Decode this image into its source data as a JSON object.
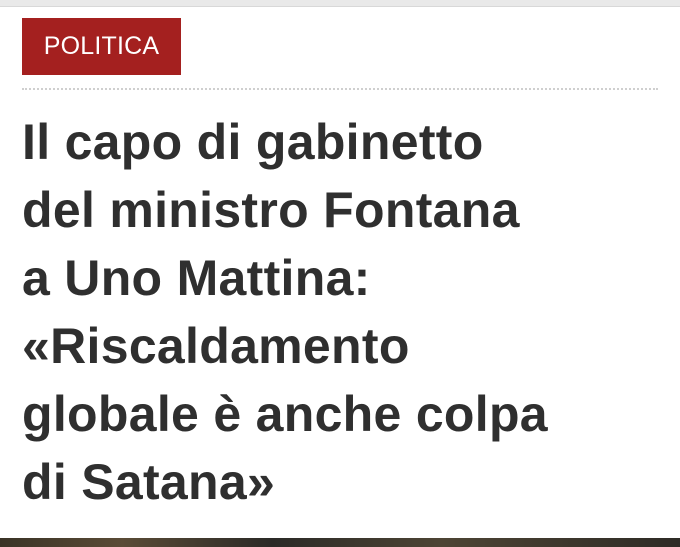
{
  "category": {
    "label": "POLITICA",
    "color": "#a4201f"
  },
  "headline": {
    "lines": [
      "Il capo di gabinetto",
      "del ministro Fontana",
      "a Uno Mattina:",
      "«Riscaldamento",
      "globale è anche colpa",
      "di Satana»"
    ],
    "color": "#2f2f2f"
  }
}
